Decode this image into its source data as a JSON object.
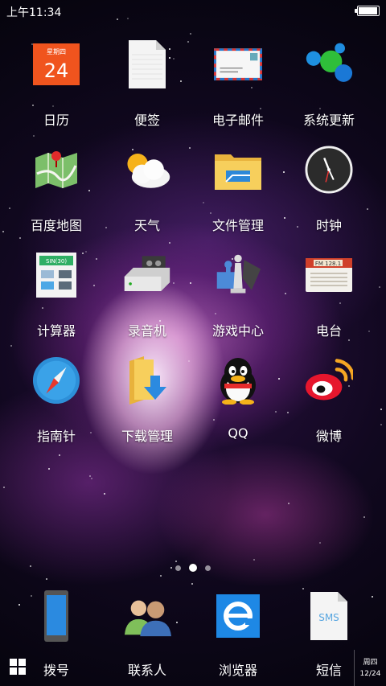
{
  "status_bar": {
    "time": "上午11:34"
  },
  "calendar_icon": {
    "weekday": "星期四",
    "day": "24"
  },
  "apps": [
    {
      "label": "日历",
      "icon": "calendar-icon"
    },
    {
      "label": "便签",
      "icon": "notes-icon"
    },
    {
      "label": "电子邮件",
      "icon": "email-icon"
    },
    {
      "label": "系统更新",
      "icon": "system-update-icon"
    },
    {
      "label": "百度地图",
      "icon": "baidu-map-icon"
    },
    {
      "label": "天气",
      "icon": "weather-icon"
    },
    {
      "label": "文件管理",
      "icon": "file-manager-icon"
    },
    {
      "label": "时钟",
      "icon": "clock-icon"
    },
    {
      "label": "计算器",
      "icon": "calculator-icon"
    },
    {
      "label": "录音机",
      "icon": "recorder-icon"
    },
    {
      "label": "游戏中心",
      "icon": "game-center-icon"
    },
    {
      "label": "电台",
      "icon": "radio-icon"
    },
    {
      "label": "指南针",
      "icon": "compass-icon"
    },
    {
      "label": "下载管理",
      "icon": "download-manager-icon"
    },
    {
      "label": "QQ",
      "icon": "qq-icon"
    },
    {
      "label": "微博",
      "icon": "weibo-icon"
    }
  ],
  "calculator_display": "SIN(30)",
  "radio_display": "FM 128.1",
  "dock": [
    {
      "label": "拨号",
      "icon": "phone-icon"
    },
    {
      "label": "联系人",
      "icon": "contacts-icon"
    },
    {
      "label": "浏览器",
      "icon": "browser-icon"
    },
    {
      "label": "短信",
      "icon": "sms-icon"
    }
  ],
  "sms_icon_text": "SMS",
  "pager": {
    "pages": 3,
    "active": 1
  },
  "taskbar_clock": {
    "weekday": "周四",
    "date": "12/24"
  }
}
